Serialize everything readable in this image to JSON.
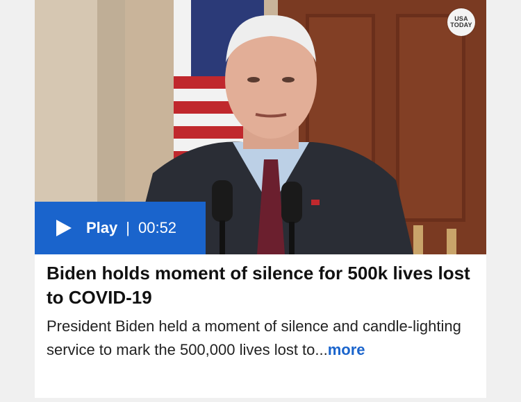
{
  "video": {
    "brand_logo_line1": "USA",
    "brand_logo_line2": "TODAY",
    "play_label": "Play",
    "separator": "|",
    "duration": "00:52",
    "accent_color": "#1a64cc"
  },
  "article": {
    "title": "Biden holds moment of silence for 500k lives lost to COVID-19",
    "summary": "President Biden held a moment of silence and candle-lighting service to mark the 500,000 lives lost to...",
    "more_label": "more"
  }
}
